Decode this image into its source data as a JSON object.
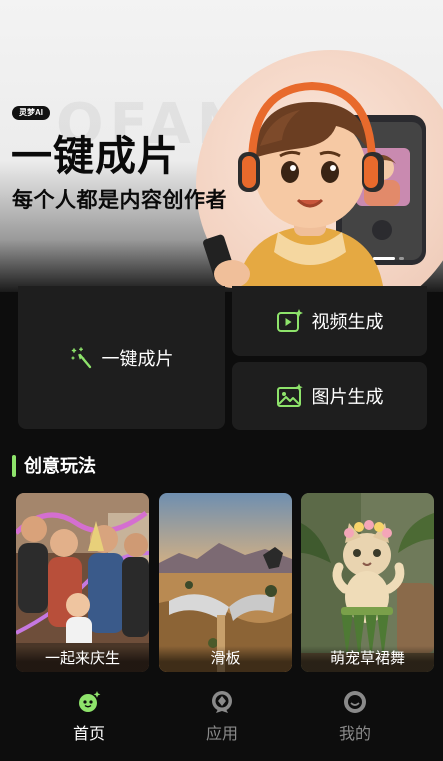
{
  "colors": {
    "accent": "#8ee36b",
    "background": "#0d0d0d",
    "card": "#1e1e1e",
    "inactive_tab": "#8a8a8a"
  },
  "hero": {
    "badge": "灵梦AI",
    "title": "一键成片",
    "subtitle": "每个人都是内容创作者",
    "watermark": "OFANCS",
    "slide_index": 1
  },
  "actions": {
    "one_click": {
      "label": "一键成片",
      "icon": "magic-wand-icon"
    },
    "video": {
      "label": "视频生成",
      "icon": "video-sparkle-icon"
    },
    "image": {
      "label": "图片生成",
      "icon": "image-sparkle-icon"
    }
  },
  "section": {
    "title": "创意玩法",
    "items": [
      {
        "label": "一起来庆生"
      },
      {
        "label": "滑板"
      },
      {
        "label": "萌宠草裙舞"
      }
    ]
  },
  "tabbar": {
    "tabs": [
      {
        "label": "首页",
        "icon": "home-face-icon",
        "active": true
      },
      {
        "label": "应用",
        "icon": "apps-badge-icon",
        "active": false
      },
      {
        "label": "我的",
        "icon": "profile-circle-icon",
        "active": false
      }
    ]
  }
}
